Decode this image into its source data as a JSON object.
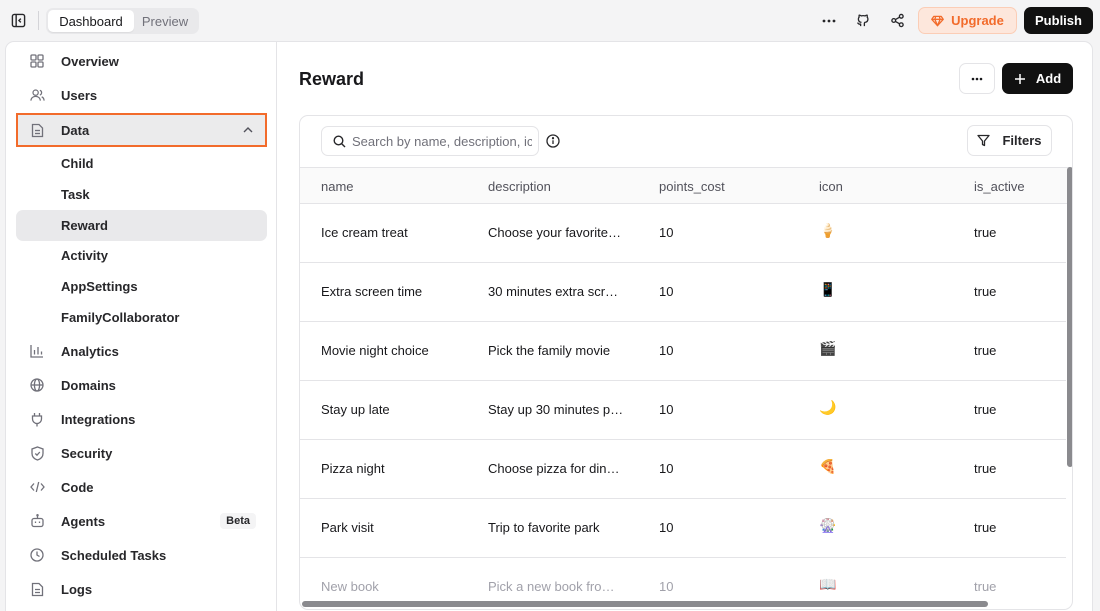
{
  "header": {
    "tabs": [
      "Dashboard",
      "Preview"
    ],
    "upgrade_label": "Upgrade",
    "publish_label": "Publish",
    "colors": {
      "upgrade_accent": "#f26b2b",
      "primary_dark": "#111111"
    }
  },
  "sidebar": {
    "items": [
      {
        "label": "Overview",
        "icon": "grid-icon"
      },
      {
        "label": "Users",
        "icon": "users-icon"
      },
      {
        "label": "Data",
        "icon": "file-icon"
      },
      {
        "label": "Analytics",
        "icon": "bar-chart-icon"
      },
      {
        "label": "Domains",
        "icon": "globe-icon"
      },
      {
        "label": "Integrations",
        "icon": "plug-icon"
      },
      {
        "label": "Security",
        "icon": "shield-icon"
      },
      {
        "label": "Code",
        "icon": "code-icon"
      },
      {
        "label": "Agents",
        "icon": "bot-icon",
        "badge": "Beta"
      },
      {
        "label": "Scheduled Tasks",
        "icon": "clock-icon"
      },
      {
        "label": "Logs",
        "icon": "log-file-icon"
      }
    ],
    "data_children": [
      "Child",
      "Task",
      "Reward",
      "Activity",
      "AppSettings",
      "FamilyCollaborator"
    ],
    "selected_child": "Reward"
  },
  "main": {
    "title": "Reward",
    "add_label": "Add",
    "search": {
      "placeholder": "Search by name, description, icon"
    },
    "filters_label": "Filters",
    "table": {
      "columns": [
        "name",
        "description",
        "points_cost",
        "icon",
        "is_active"
      ],
      "rows": [
        {
          "name": "Ice cream treat",
          "description": "Choose your favorite…",
          "points_cost": "10",
          "icon": "🍦",
          "is_active": "true"
        },
        {
          "name": "Extra screen time",
          "description": "30 minutes extra scr…",
          "points_cost": "10",
          "icon": "📱",
          "is_active": "true"
        },
        {
          "name": "Movie night choice",
          "description": "Pick the family movie",
          "points_cost": "10",
          "icon": "🎬",
          "is_active": "true"
        },
        {
          "name": "Stay up late",
          "description": "Stay up 30 minutes p…",
          "points_cost": "10",
          "icon": "🌙",
          "is_active": "true"
        },
        {
          "name": "Pizza night",
          "description": "Choose pizza for din…",
          "points_cost": "10",
          "icon": "🍕",
          "is_active": "true"
        },
        {
          "name": "Park visit",
          "description": "Trip to favorite park",
          "points_cost": "10",
          "icon": "🎡",
          "is_active": "true"
        },
        {
          "name": "New book",
          "description": "Pick a new book fro…",
          "points_cost": "10",
          "icon": "📖",
          "is_active": "true"
        }
      ]
    }
  }
}
